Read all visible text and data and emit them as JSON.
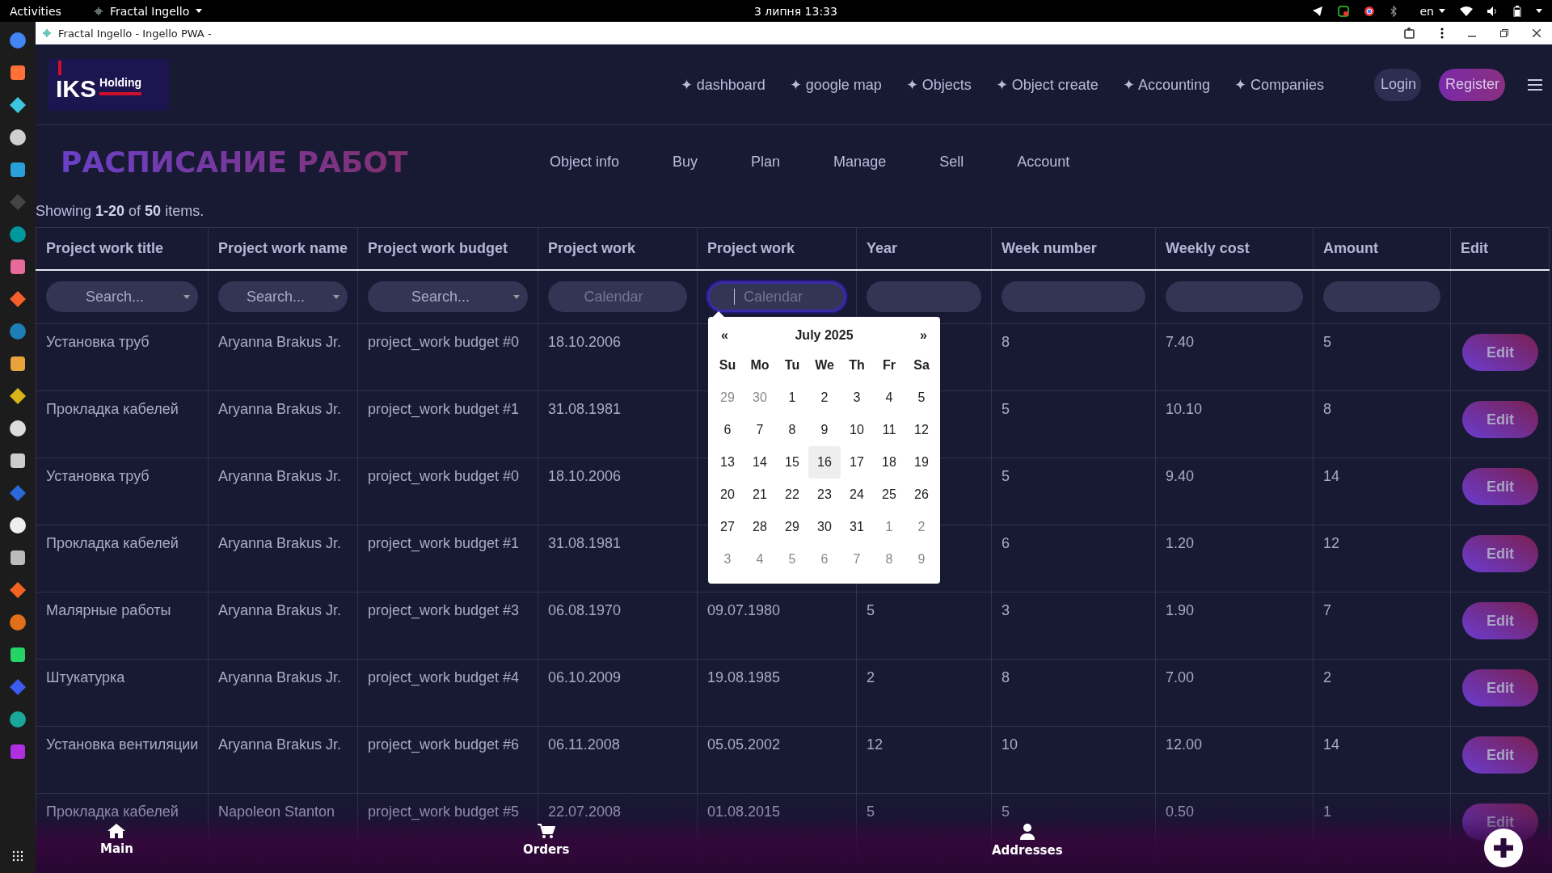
{
  "system_bar": {
    "activities": "Activities",
    "app_menu": "Fractal Ingello",
    "clock": "3 липня  13:33",
    "language": "en"
  },
  "window": {
    "title": "Fractal Ingello - Ingello PWA -"
  },
  "header": {
    "logo": {
      "main": "IKS",
      "sub": "Holding"
    },
    "nav": [
      "✦ dashboard",
      "✦ google map",
      "✦ Objects",
      "✦ Object create",
      "✦ Accounting",
      "✦ Companies"
    ],
    "login": "Login",
    "register": "Register"
  },
  "page": {
    "title": "РАСПИСАНИЕ РАБОТ",
    "tabs": [
      "Object info",
      "Buy",
      "Plan",
      "Manage",
      "Sell",
      "Account"
    ]
  },
  "summary": "Showing **1-20** of **50** items.",
  "table": {
    "columns": [
      "Project work title",
      "Project work name",
      "Project work budget",
      "Project work",
      "Project work",
      "Year",
      "Week number",
      "Weekly cost",
      "Amount",
      "Edit"
    ],
    "filters": [
      {
        "kind": "search",
        "placeholder": "Search...",
        "focused": false
      },
      {
        "kind": "search",
        "placeholder": "Search...",
        "focused": false
      },
      {
        "kind": "search",
        "placeholder": "Search...",
        "focused": false
      },
      {
        "kind": "calendar",
        "placeholder": "Calendar",
        "focused": false
      },
      {
        "kind": "calendar",
        "placeholder": "Calendar",
        "focused": true
      },
      {
        "kind": "text",
        "focused": false
      },
      {
        "kind": "text",
        "focused": false
      },
      {
        "kind": "text",
        "focused": false
      },
      {
        "kind": "text",
        "focused": false
      },
      {
        "kind": "none",
        "focused": false
      }
    ],
    "rows": [
      {
        "cells": [
          "Установка труб",
          "Aryanna Brakus Jr.",
          "project_work budget #0",
          "18.10.2006",
          null,
          null,
          "8",
          "7.40",
          "5"
        ],
        "action": "Edit"
      },
      {
        "cells": [
          "Прокладка кабелей",
          "Aryanna Brakus Jr.",
          "project_work budget #1",
          "31.08.1981",
          null,
          null,
          "5",
          "10.10",
          "8"
        ],
        "action": "Edit"
      },
      {
        "cells": [
          "Установка труб",
          "Aryanna Brakus Jr.",
          "project_work budget #0",
          "18.10.2006",
          null,
          null,
          "5",
          "9.40",
          "14"
        ],
        "action": "Edit"
      },
      {
        "cells": [
          "Прокладка кабелей",
          "Aryanna Brakus Jr.",
          "project_work budget #1",
          "31.08.1981",
          null,
          null,
          "6",
          "1.20",
          "12"
        ],
        "action": "Edit"
      },
      {
        "cells": [
          "Малярные работы",
          "Aryanna Brakus Jr.",
          "project_work budget #3",
          "06.08.1970",
          "09.07.1980",
          "5",
          "3",
          "1.90",
          "7"
        ],
        "action": "Edit"
      },
      {
        "cells": [
          "Штукатурка",
          "Aryanna Brakus Jr.",
          "project_work budget #4",
          "06.10.2009",
          "19.08.1985",
          "2",
          "8",
          "7.00",
          "2"
        ],
        "action": "Edit"
      },
      {
        "cells": [
          "Установка вентиляции",
          "Aryanna Brakus Jr.",
          "project_work budget #6",
          "06.11.2008",
          "05.05.2002",
          "12",
          "10",
          "12.00",
          "14"
        ],
        "action": "Edit"
      },
      {
        "cells": [
          "Прокладка кабелей",
          "Napoleon Stanton",
          "project_work budget #5",
          "22.07.2008",
          "01.08.2015",
          "5",
          "5",
          "0.50",
          "1"
        ],
        "action": "Edit"
      }
    ]
  },
  "calendar": {
    "title": "July 2025",
    "prev": "«",
    "next": "»",
    "weekdays": [
      "Su",
      "Mo",
      "Tu",
      "We",
      "Th",
      "Fr",
      "Sa"
    ],
    "weeks": [
      [
        {
          "day": "29",
          "muted": true,
          "selected": false
        },
        {
          "day": "30",
          "muted": true,
          "selected": false
        },
        {
          "day": "1",
          "muted": false,
          "selected": false
        },
        {
          "day": "2",
          "muted": false,
          "selected": false
        },
        {
          "day": "3",
          "muted": false,
          "selected": false
        },
        {
          "day": "4",
          "muted": false,
          "selected": false
        },
        {
          "day": "5",
          "muted": false,
          "selected": false
        }
      ],
      [
        {
          "day": "6",
          "muted": false,
          "selected": false
        },
        {
          "day": "7",
          "muted": false,
          "selected": false
        },
        {
          "day": "8",
          "muted": false,
          "selected": false
        },
        {
          "day": "9",
          "muted": false,
          "selected": false
        },
        {
          "day": "10",
          "muted": false,
          "selected": false
        },
        {
          "day": "11",
          "muted": false,
          "selected": false
        },
        {
          "day": "12",
          "muted": false,
          "selected": false
        }
      ],
      [
        {
          "day": "13",
          "muted": false,
          "selected": false
        },
        {
          "day": "14",
          "muted": false,
          "selected": false
        },
        {
          "day": "15",
          "muted": false,
          "selected": false
        },
        {
          "day": "16",
          "muted": false,
          "selected": true
        },
        {
          "day": "17",
          "muted": false,
          "selected": false
        },
        {
          "day": "18",
          "muted": false,
          "selected": false
        },
        {
          "day": "19",
          "muted": false,
          "selected": false
        }
      ],
      [
        {
          "day": "20",
          "muted": false,
          "selected": false
        },
        {
          "day": "21",
          "muted": false,
          "selected": false
        },
        {
          "day": "22",
          "muted": false,
          "selected": false
        },
        {
          "day": "23",
          "muted": false,
          "selected": false
        },
        {
          "day": "24",
          "muted": false,
          "selected": false
        },
        {
          "day": "25",
          "muted": false,
          "selected": false
        },
        {
          "day": "26",
          "muted": false,
          "selected": false
        }
      ],
      [
        {
          "day": "27",
          "muted": false,
          "selected": false
        },
        {
          "day": "28",
          "muted": false,
          "selected": false
        },
        {
          "day": "29",
          "muted": false,
          "selected": false
        },
        {
          "day": "30",
          "muted": false,
          "selected": false
        },
        {
          "day": "31",
          "muted": false,
          "selected": false
        },
        {
          "day": "1",
          "muted": true,
          "selected": false
        },
        {
          "day": "2",
          "muted": true,
          "selected": false
        }
      ],
      [
        {
          "day": "3",
          "muted": true,
          "selected": false
        },
        {
          "day": "4",
          "muted": true,
          "selected": false
        },
        {
          "day": "5",
          "muted": true,
          "selected": false
        },
        {
          "day": "6",
          "muted": true,
          "selected": false
        },
        {
          "day": "7",
          "muted": true,
          "selected": false
        },
        {
          "day": "8",
          "muted": true,
          "selected": false
        },
        {
          "day": "9",
          "muted": true,
          "selected": false
        }
      ]
    ]
  },
  "bottom_nav": {
    "items": [
      "Main",
      "Orders",
      "Addresses"
    ]
  }
}
